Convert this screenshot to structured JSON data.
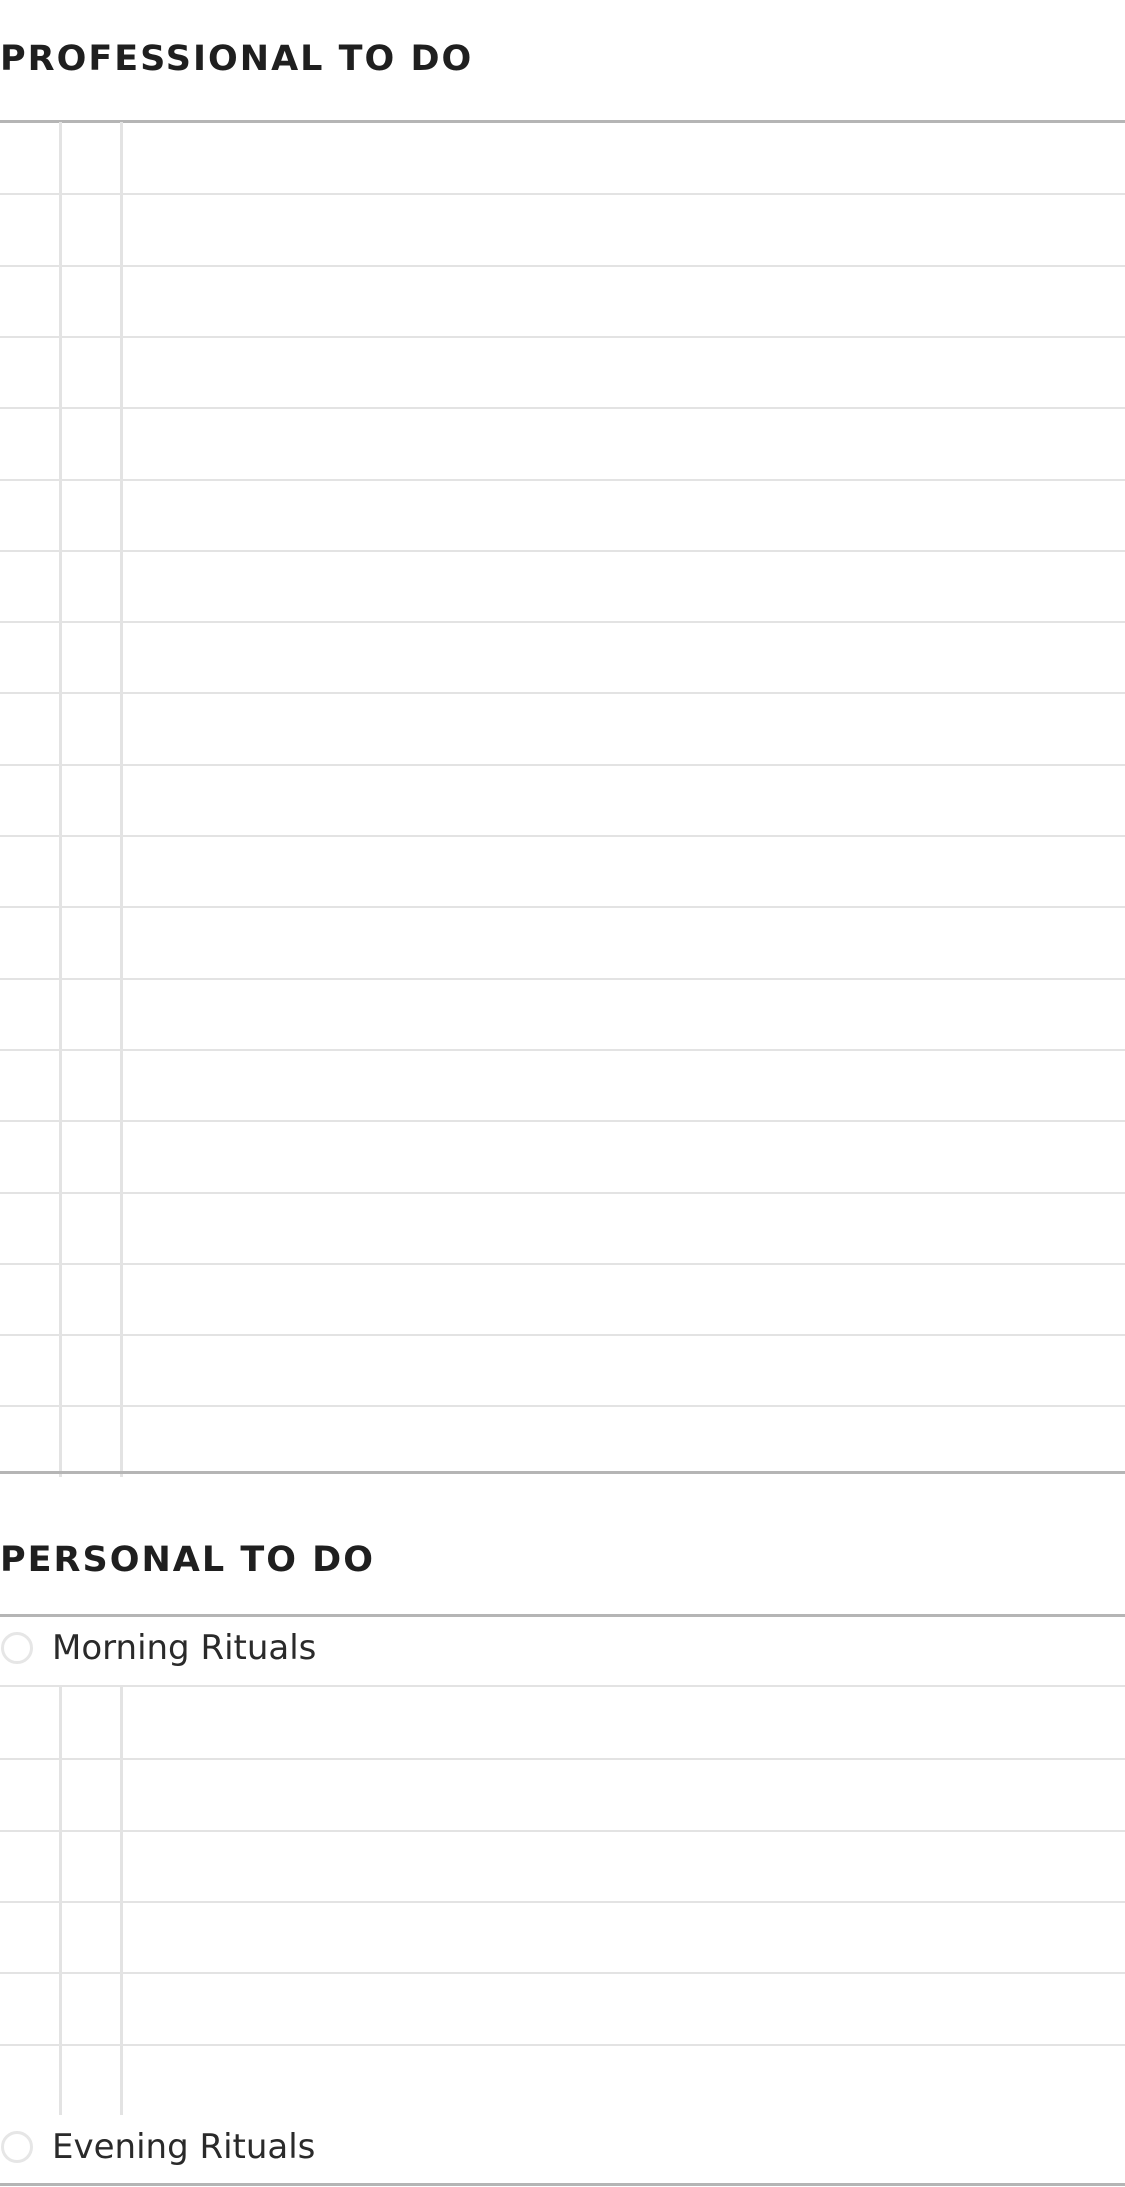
{
  "professional": {
    "title": "PROFESSIONAL TO DO",
    "row_count": 19
  },
  "personal": {
    "title": "PERSONAL TO DO",
    "morning": {
      "label": "Morning Rituals",
      "icon": "radio-circle-icon"
    },
    "evening": {
      "label": "Evening Rituals",
      "icon": "radio-circle-icon"
    },
    "row_count": 6
  },
  "colors": {
    "heading": "#1f1f1f",
    "text": "#2a2a2a",
    "rule_light": "#e3e3e3",
    "rule_strong": "#b5b5b5",
    "background": "#ffffff"
  }
}
